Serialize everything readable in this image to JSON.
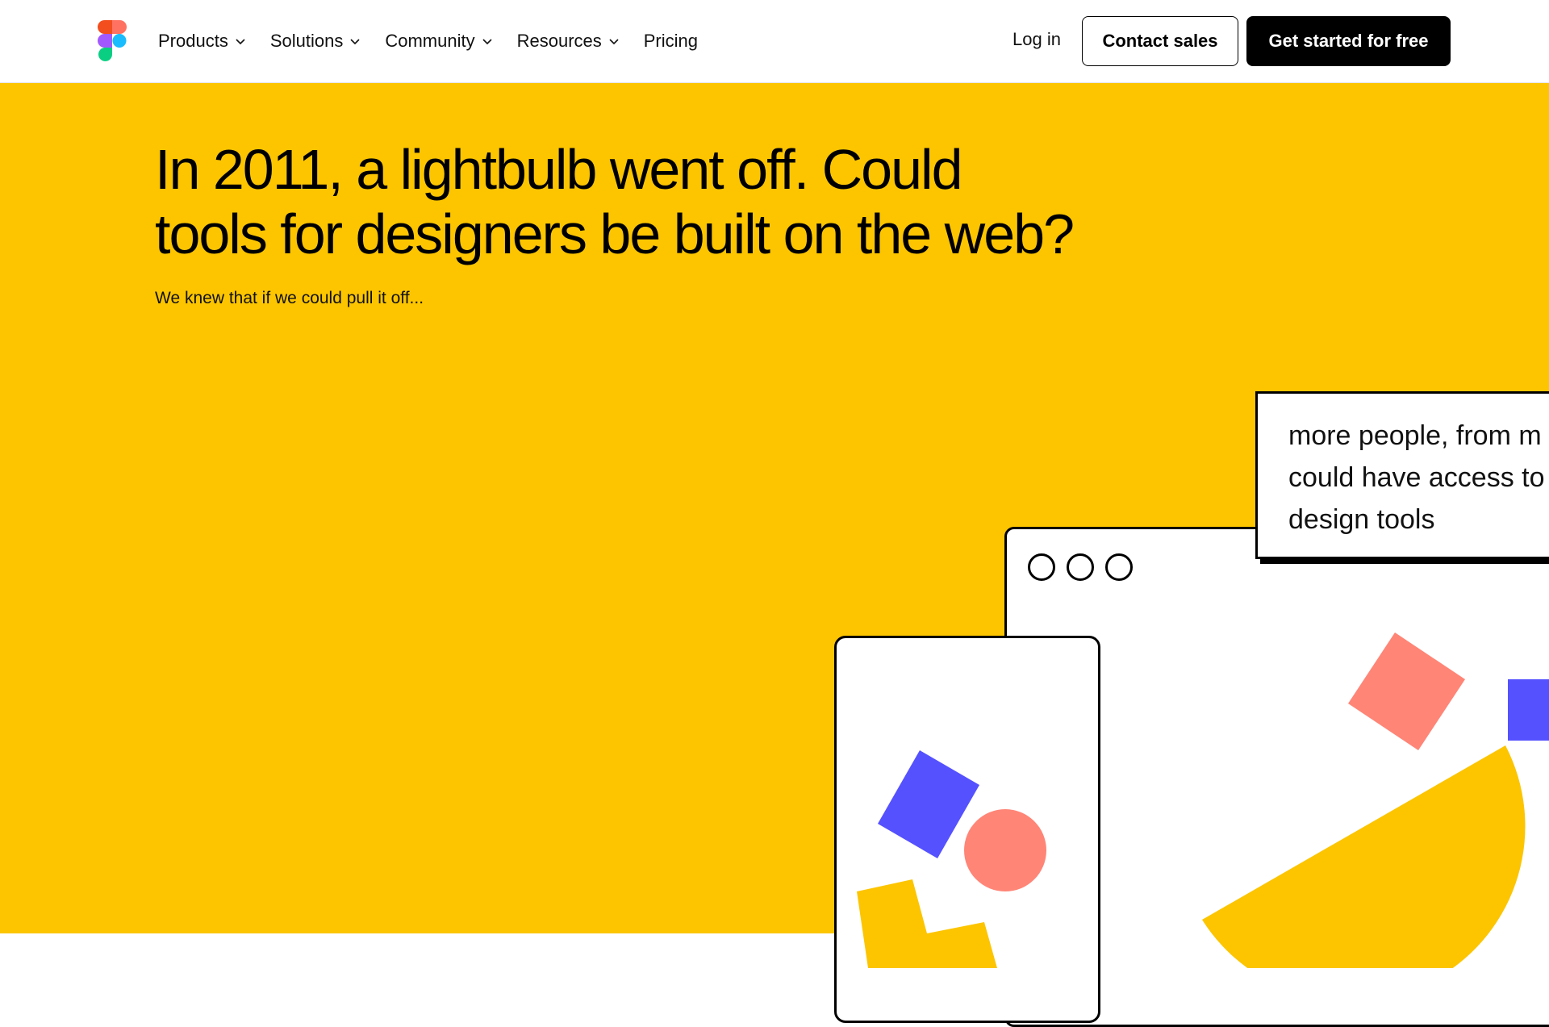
{
  "nav": {
    "items": [
      {
        "label": "Products",
        "dropdown": true
      },
      {
        "label": "Solutions",
        "dropdown": true
      },
      {
        "label": "Community",
        "dropdown": true
      },
      {
        "label": "Resources",
        "dropdown": true
      },
      {
        "label": "Pricing",
        "dropdown": false
      }
    ],
    "login": "Log in",
    "contact_sales": "Contact sales",
    "get_started": "Get started for free"
  },
  "hero": {
    "headline_line1": "In 2011, a lightbulb went off. Could",
    "headline_line2": "tools for designers be built on the web?",
    "subtext": "We knew that if we could pull it off...",
    "background": "#fcc500"
  },
  "illustration": {
    "caption_lines": [
      "more people, from m",
      "could have access to",
      "design tools"
    ],
    "colors": {
      "blue": "#5551ff",
      "coral": "#ff8577",
      "yellow": "#fcc500"
    }
  }
}
